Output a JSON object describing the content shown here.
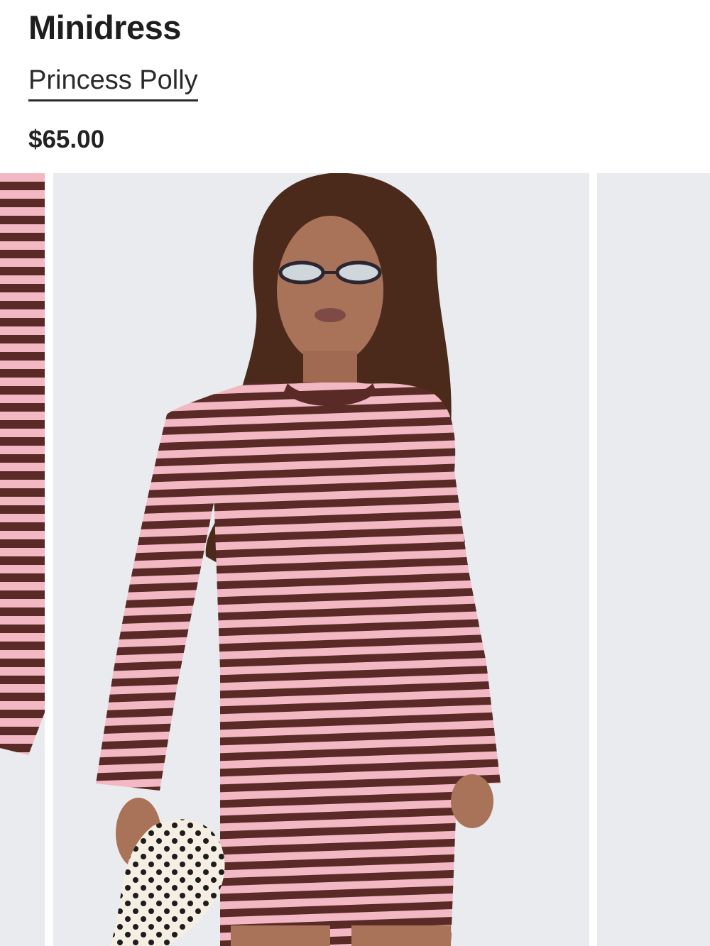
{
  "product": {
    "title": "Minidress",
    "brand": "Princess Polly",
    "price": "$65.00"
  },
  "gallery": {
    "slides": [
      {
        "name": "previous-product-image"
      },
      {
        "name": "current-product-image"
      },
      {
        "name": "next-product-image"
      }
    ]
  },
  "colors": {
    "stripe_pink": "#f2b9c4",
    "stripe_brown": "#5a2a27",
    "backdrop": "#e9ebef"
  }
}
